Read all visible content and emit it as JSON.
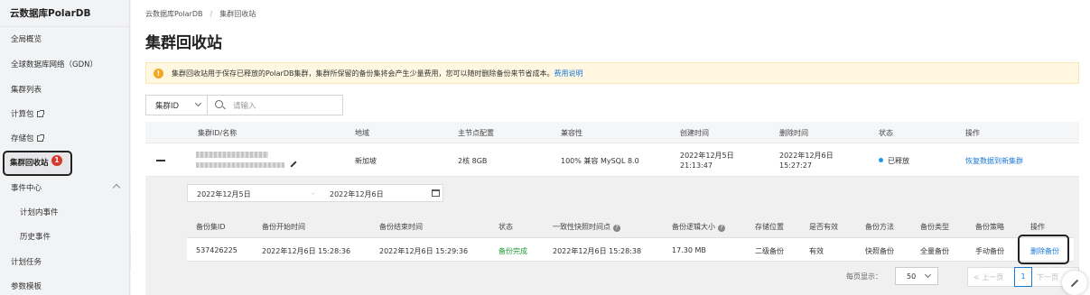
{
  "sidebar": {
    "title": "云数据库PolarDB",
    "items": [
      {
        "label": "全局概览"
      },
      {
        "label": "全球数据库网络（GDN）"
      },
      {
        "label": "集群列表"
      },
      {
        "label": "计算包"
      },
      {
        "label": "存储包"
      },
      {
        "label": "集群回收站",
        "badge": "1"
      },
      {
        "label": "事件中心"
      },
      {
        "label": "计划内事件"
      },
      {
        "label": "历史事件"
      },
      {
        "label": "计划任务"
      },
      {
        "label": "参数模板"
      }
    ]
  },
  "breadcrumb": {
    "root": "云数据库PolarDB",
    "sep": "/",
    "current": "集群回收站"
  },
  "page_title": "集群回收站",
  "notice": {
    "icon": "!",
    "text": "集群回收站用于保存已释放的PolarDB集群，集群所保留的备份集将会产生少量费用，您可以随时删除备份来节省成本。",
    "link": "费用说明"
  },
  "search": {
    "field": "集群ID",
    "placeholder": "请输入"
  },
  "cluster_table": {
    "headers": [
      "集群ID/名称",
      "地域",
      "主节点配置",
      "兼容性",
      "创建时间",
      "删除时间",
      "状态",
      "操作"
    ],
    "row": {
      "region": "新加坡",
      "spec": "2核 8GB",
      "compat": "100% 兼容 MySQL 8.0",
      "created_date": "2022年12月5日",
      "created_time": "21:13:47",
      "deleted_date": "2022年12月6日",
      "deleted_time": "15:27:27",
      "status": "已释放",
      "action": "恢复数据到新集群"
    }
  },
  "backup_panel": {
    "date_start": "2022年12月5日",
    "date_sep": "-",
    "date_end": "2022年12月6日",
    "headers": [
      "备份集ID",
      "备份开始时间",
      "备份结束时间",
      "状态",
      "一致性快照时间点",
      "备份逻辑大小",
      "存储位置",
      "是否有效",
      "备份方法",
      "备份类型",
      "备份策略",
      "操作"
    ],
    "row": {
      "id": "537426225",
      "start": "2022年12月6日 15:28:36",
      "end": "2022年12月6日 15:29:36",
      "status": "备份完成",
      "snapshot": "2022年12月6日 15:28:38",
      "size": "17.30 MB",
      "location": "二级备份",
      "valid": "有效",
      "method": "快照备份",
      "type": "全量备份",
      "policy": "手动备份",
      "action": "删除备份"
    }
  },
  "pagination": {
    "label": "每页显示：",
    "page_size": "50",
    "prev": "上一页",
    "current": "1",
    "next": "下一页"
  },
  "colors": {
    "link": "#1a7ad6",
    "success": "#1e9b35",
    "badge": "#d9362c",
    "notice_bg": "#fff7e0"
  }
}
